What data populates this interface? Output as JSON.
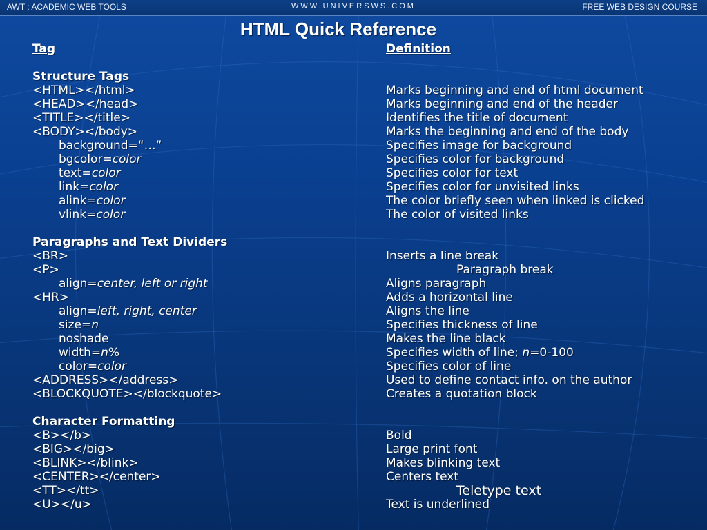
{
  "top_bar": {
    "left": "AWT : ACADEMIC WEB TOOLS",
    "center": "WWW.UNIVERSWS.COM",
    "right": "FREE WEB DESIGN COURSE"
  },
  "title": "HTML Quick Reference",
  "header": {
    "tag": "Tag",
    "definition": "Definition"
  },
  "sections": [
    {
      "title": "Structure Tags",
      "rows": [
        {
          "tag": "<HTML></html>",
          "def": "Marks beginning and end of html document"
        },
        {
          "tag": "<HEAD></head>",
          "def": "Marks beginning and end of the header"
        },
        {
          "tag": "<TITLE></title>",
          "def": "Identifies the title of document"
        },
        {
          "tag": "<BODY></body>",
          "def": "Marks the beginning and end of the body"
        },
        {
          "tag_prefix": "background=",
          "tag_italic": "“…”",
          "def": "Specifies image for background"
        },
        {
          "tag_prefix": "bgcolor=",
          "tag_italic": "color",
          "def": "Specifies color for background"
        },
        {
          "tag_prefix": "text=",
          "tag_italic": "color",
          "def": "Specifies color for text"
        },
        {
          "tag_prefix": "link=",
          "tag_italic": "color",
          "def": "Specifies color for unvisited links"
        },
        {
          "tag_prefix": "alink=",
          "tag_italic": "color",
          "def": "The color briefly seen when linked is clicked"
        },
        {
          "tag_prefix": "vlink=",
          "tag_italic": "color",
          "def": "The color of visited links"
        }
      ]
    },
    {
      "title": "Paragraphs and Text Dividers",
      "rows": [
        {
          "tag": "<BR>",
          "def": "Inserts a line break"
        },
        {
          "tag": "<P>",
          "def": "Paragraph break"
        },
        {
          "tag_prefix": "align=",
          "tag_italic": "center, left or right",
          "def": "Aligns paragraph"
        },
        {
          "tag": "<HR>",
          "def": "Adds a horizontal line"
        },
        {
          "tag_prefix": "align=",
          "tag_italic": "left, right, center",
          "def": "Aligns the line"
        },
        {
          "tag_prefix": "size=",
          "tag_italic": "n",
          "def": "Specifies thickness of line"
        },
        {
          "tag": "noshade",
          "def": "Makes the line black"
        },
        {
          "tag_prefix": "width=",
          "tag_italic": "n",
          "tag_suffix": "%",
          "def_prefix": "Specifies width of line; ",
          "def_italic": "n",
          "def_suffix": "=0-100"
        },
        {
          "tag_prefix": "color=",
          "tag_italic": "color",
          "def": "Specifies color of line"
        },
        {
          "tag": "<ADDRESS></address>",
          "def": "Used to define contact info. on the author"
        },
        {
          "tag": "<BLOCKQUOTE></blockquote>",
          "def": "Creates a quotation block"
        }
      ]
    },
    {
      "title": "Character Formatting",
      "rows": [
        {
          "tag": "<B></b>",
          "def": "Bold"
        },
        {
          "tag": "<BIG></big>",
          "def": "Large print font"
        },
        {
          "tag": "<BLINK></blink>",
          "def": "Makes blinking text"
        },
        {
          "tag": "<CENTER></center>",
          "def": "Centers text"
        },
        {
          "tag": "<TT></tt>",
          "def": "Teletype text"
        },
        {
          "tag": "<U></u>",
          "def": "Text is underlined"
        }
      ]
    }
  ]
}
